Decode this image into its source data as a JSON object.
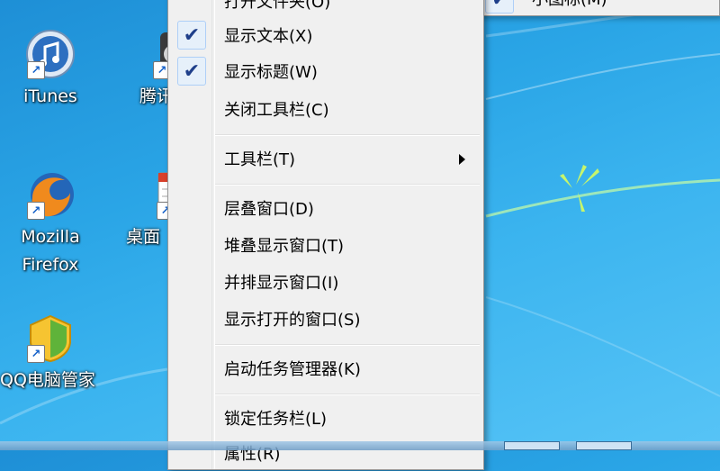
{
  "desktop": {
    "icons": [
      {
        "label_line1": "iTunes",
        "label_line2": ""
      },
      {
        "label_line1": "腾讯",
        "label_line2": ""
      },
      {
        "label_line1": "Mozilla",
        "label_line2": "Firefox"
      },
      {
        "label_line1": "桌面",
        "label_line2": ""
      },
      {
        "label_line1": "QQ电脑管家",
        "label_line2": ""
      }
    ]
  },
  "context_menu": {
    "items": [
      {
        "label": "打开文件夹(O)",
        "checked": false
      },
      {
        "label": "显示文本(X)",
        "checked": true
      },
      {
        "label": "显示标题(W)",
        "checked": true
      },
      {
        "label": "关闭工具栏(C)",
        "checked": false
      },
      {
        "label": "工具栏(T)",
        "submenu": true
      },
      {
        "label": "层叠窗口(D)"
      },
      {
        "label": "堆叠显示窗口(T)"
      },
      {
        "label": "并排显示窗口(I)"
      },
      {
        "label": "显示打开的窗口(S)"
      },
      {
        "label": "启动任务管理器(K)"
      },
      {
        "label": "锁定任务栏(L)"
      },
      {
        "label": "属性(R)"
      }
    ]
  },
  "submenu": {
    "item": {
      "label": "小图标(M)",
      "checked": true
    }
  },
  "icons": {
    "check": "checkmark-icon",
    "submenu_arrow": "chevron-right-icon",
    "shortcut": "shortcut-arrow-icon"
  },
  "colors": {
    "desktop_blue": "#2aa5e6",
    "menu_bg": "#f0f0f0",
    "check_bg": "#e6f0fa"
  }
}
